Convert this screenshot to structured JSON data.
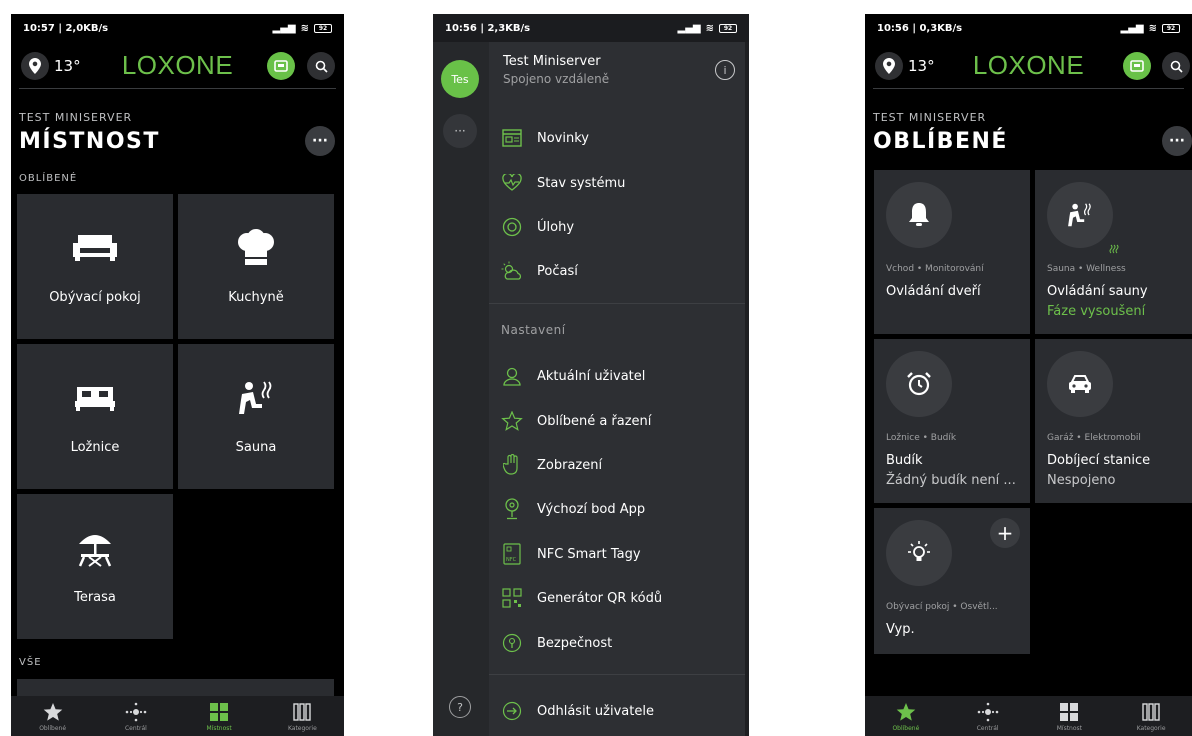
{
  "screen1": {
    "status": {
      "time": "10:57 | 2,0KB/s",
      "battery": "92"
    },
    "temperature": "13°",
    "brand": "LOXONE",
    "server": "TEST MINISERVER",
    "title": "MÍSTNOST",
    "favorites_label": "OBLÍBENÉ",
    "all_label": "VŠE",
    "rooms": [
      {
        "label": "Obývací pokoj",
        "icon": "sofa-icon"
      },
      {
        "label": "Kuchyně",
        "icon": "chef-hat-icon"
      },
      {
        "label": "Ložnice",
        "icon": "bed-icon"
      },
      {
        "label": "Sauna",
        "icon": "sauna-icon"
      },
      {
        "label": "Terasa",
        "icon": "parasol-icon"
      }
    ]
  },
  "tabs": [
    {
      "label": "Oblíbené",
      "icon": "star-icon"
    },
    {
      "label": "Centrál",
      "icon": "central-icon"
    },
    {
      "label": "Místnost",
      "icon": "grid-icon"
    },
    {
      "label": "Kategorie",
      "icon": "columns-icon"
    }
  ],
  "screen2": {
    "status": {
      "time": "10:56 | 2,3KB/s",
      "battery": "92"
    },
    "avatar": "Tes",
    "rail_more": "···",
    "server_title": "Test Miniserver",
    "server_sub": "Spojeno vzdáleně",
    "info": "i",
    "help": "?",
    "menu_top": [
      {
        "label": "Novinky",
        "icon": "news-icon"
      },
      {
        "label": "Stav systému",
        "icon": "heartbeat-icon"
      },
      {
        "label": "Úlohy",
        "icon": "target-icon"
      },
      {
        "label": "Počasí",
        "icon": "weather-icon"
      }
    ],
    "settings_label": "Nastavení",
    "menu_settings": [
      {
        "label": "Aktuální uživatel",
        "icon": "user-icon"
      },
      {
        "label": "Oblíbené a řazení",
        "icon": "star-outline-icon"
      },
      {
        "label": "Zobrazení",
        "icon": "hand-icon"
      },
      {
        "label": "Výchozí bod App",
        "icon": "pin-icon"
      },
      {
        "label": "NFC Smart Tagy",
        "icon": "nfc-icon"
      },
      {
        "label": "Generátor QR kódů",
        "icon": "qr-icon"
      },
      {
        "label": "Bezpečnost",
        "icon": "lock-icon"
      }
    ],
    "logout": "Odhlásit uživatele"
  },
  "screen3": {
    "status": {
      "time": "10:56 | 0,3KB/s",
      "battery": "92"
    },
    "temperature": "13°",
    "brand": "LOXONE",
    "server": "TEST MINISERVER",
    "title": "OBLÍBENÉ",
    "favorites": [
      {
        "room": "Vchod • Monitorování",
        "name": "Ovládání dveří",
        "state": "",
        "icon": "bell-icon"
      },
      {
        "room": "Sauna • Wellness",
        "name": "Ovládání sauny",
        "state": "Fáze vysoušení",
        "icon": "sauna-icon",
        "state_color": "#6dc04b"
      },
      {
        "room": "Ložnice • Budík",
        "name": "Budík",
        "state": "Žádný budík není ...",
        "icon": "alarm-clock-icon",
        "state_color": "#c8c9cb"
      },
      {
        "room": "Garáž • Elektromobil",
        "name": "Dobíjecí stanice",
        "state": "Nespojeno",
        "icon": "car-icon",
        "state_color": "#c8c9cb"
      },
      {
        "room": "Obývací pokoj • Osvětl...",
        "name": "Vyp.",
        "state": "",
        "icon": "bulb-icon"
      }
    ]
  },
  "colors": {
    "accent": "#6dc04b",
    "tile": "#2a2c30",
    "background": "#000000",
    "drawer": "#2d2f33"
  }
}
